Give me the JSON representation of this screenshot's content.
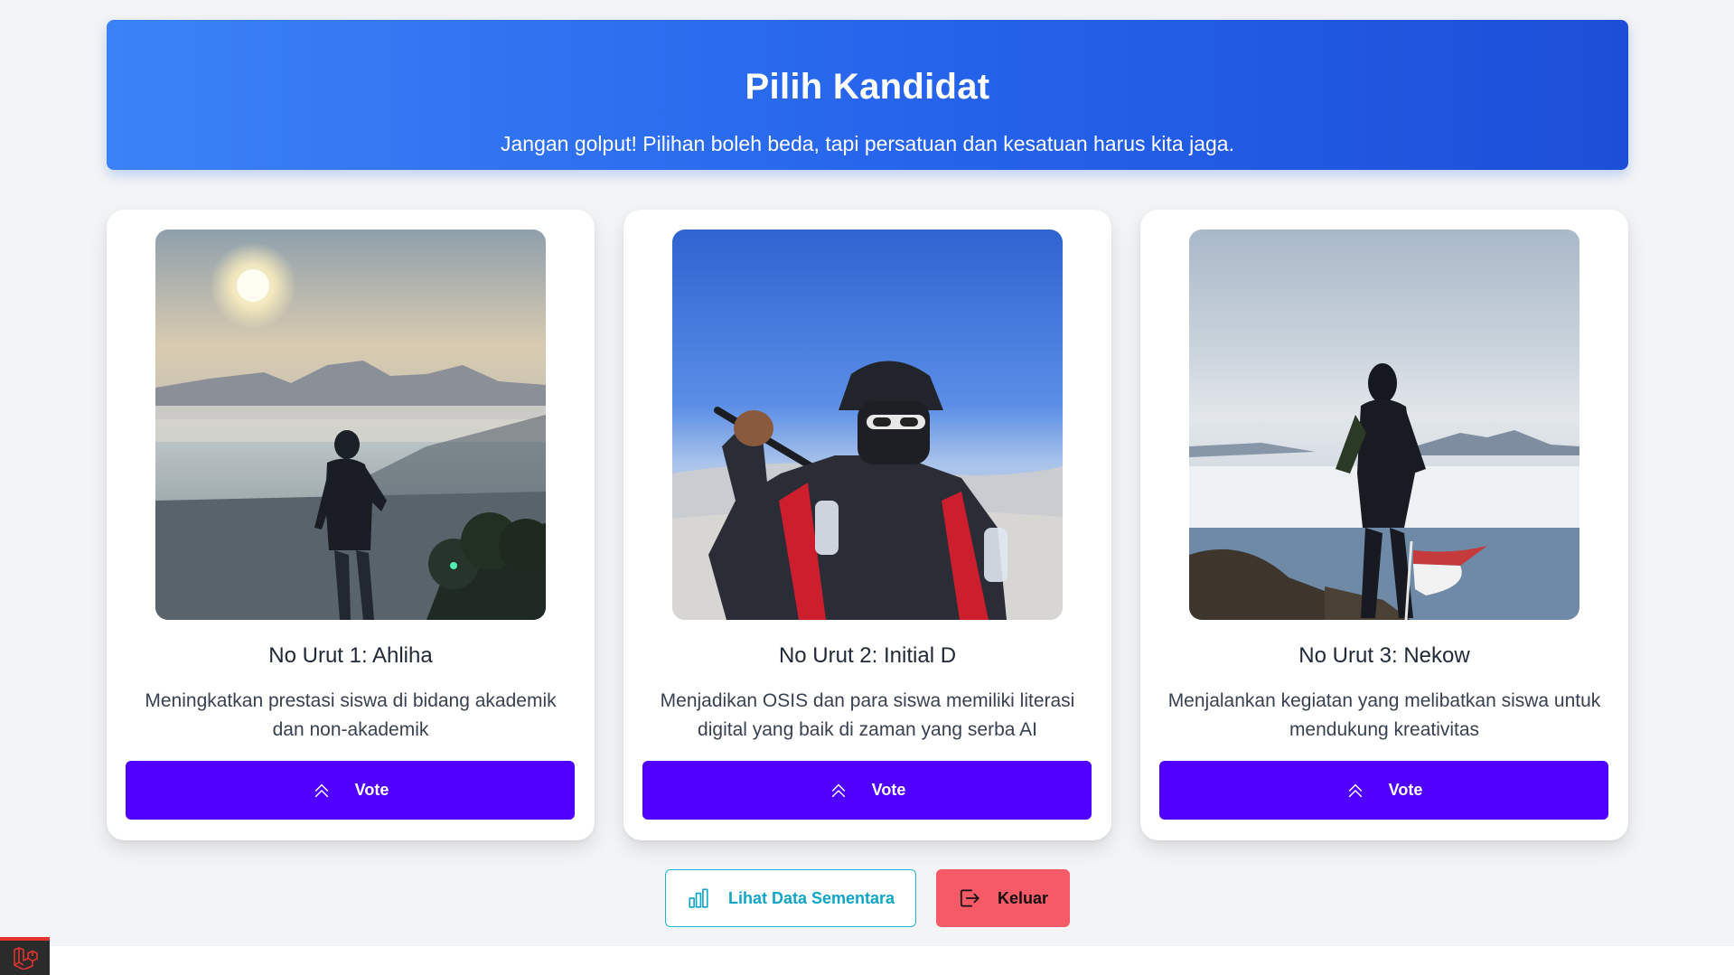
{
  "header": {
    "title": "Pilih Kandidat",
    "subtitle": "Jangan golput! Pilihan boleh beda, tapi persatuan dan kesatuan harus kita jaga."
  },
  "candidates": [
    {
      "name": "No Urut 1: Ahliha",
      "vision": "Meningkatkan prestasi siswa di bidang akademik dan non-akademik",
      "vote_label": "Vote",
      "photo": "hiker silhouette at sunrise above sea of clouds"
    },
    {
      "name": "No Urut 2: Initial D",
      "vision": "Menjadikan OSIS dan para siswa memiliki literasi digital yang baik di zaman yang serba AI",
      "vote_label": "Vote",
      "photo": "masked hiker with trekking pole against blue sky"
    },
    {
      "name": "No Urut 3: Nekow",
      "vision": "Menjalankan kegiatan yang melibatkan siswa untuk mendukung kreativitas",
      "vote_label": "Vote",
      "photo": "hiker silhouette on summit with red and white flag"
    }
  ],
  "actions": {
    "view_data_label": "Lihat Data Sementara",
    "logout_label": "Keluar"
  },
  "icons": {
    "vote": "chevron-double-up-icon",
    "view_data": "bar-chart-icon",
    "logout": "logout-icon",
    "debug": "laravel-logo-icon"
  },
  "colors": {
    "header_gradient_start": "#3b82f6",
    "header_gradient_end": "#1d4ed8",
    "vote_button": "#4f00ff",
    "view_data_border": "#22b5d3",
    "logout_button": "#f75a67"
  }
}
